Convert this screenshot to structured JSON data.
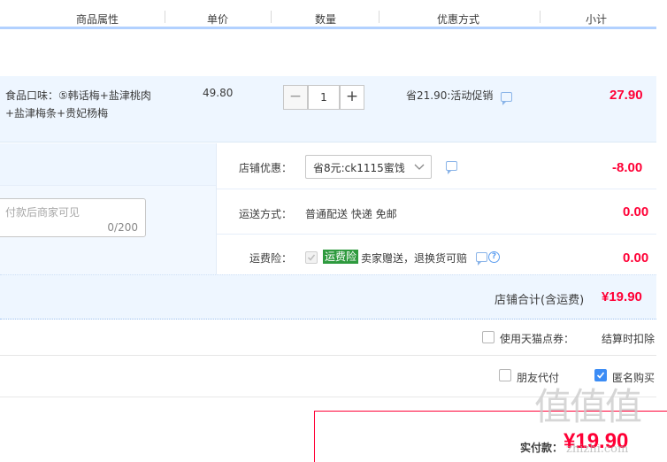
{
  "header": {
    "columns": [
      "商品属性",
      "单价",
      "数量",
      "优惠方式",
      "小计"
    ]
  },
  "item": {
    "attributes_line1": "食品口味：⑤韩话梅+盐津桃肉",
    "attributes_line2": "+盐津梅条+贵妃杨梅",
    "unit_price": "49.80",
    "quantity": "1",
    "minus_label": "−",
    "plus_label": "+",
    "discount": "省21.90:活动促销",
    "subtotal": "27.90"
  },
  "shop": {
    "coupon_label": "店铺优惠：",
    "coupon_select": "省8元:ck1115蜜饯",
    "coupon_amount": "-8.00",
    "memo_placeholder": "付款后商家可见",
    "memo_counter": "0/200",
    "shipping_label": "运送方式：",
    "shipping_value": "普通配送 快递 免邮",
    "shipping_amount": "0.00",
    "insurance_label": "运费险：",
    "insurance_tag": "运费险",
    "insurance_text": "卖家赠送，退换货可赔",
    "insurance_amount": "0.00",
    "total_label": "店铺合计(含运费)",
    "total_amount": "¥19.90"
  },
  "tmall_points": {
    "label": "使用天猫点券：",
    "note": "结算时扣除"
  },
  "options": {
    "friend_pay": "朋友代付",
    "anonymous": "匿名购买"
  },
  "payment": {
    "label": "实付款：",
    "amount": "¥19.90"
  },
  "watermark": {
    "text": "值值值",
    "url": "zhizhi.com"
  },
  "colors": {
    "price_red": "#ff0036",
    "header_line": "#b2d1ff",
    "section_bg": "#eef6ff",
    "tag_green": "#2e9a3e",
    "checkbox_blue": "#3b8cf5"
  }
}
